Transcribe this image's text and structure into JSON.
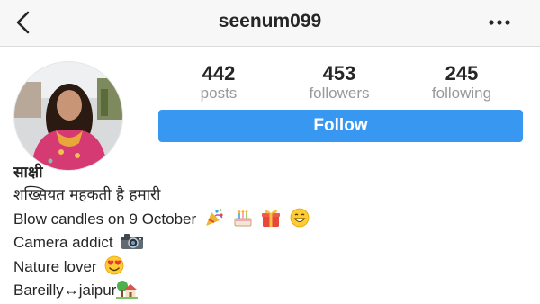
{
  "header": {
    "username": "seenum099",
    "back_icon": "chevron-left-icon",
    "more_icon": "more-horizontal-icon"
  },
  "profile": {
    "avatar_description": "profile-photo",
    "stats": [
      {
        "value": "442",
        "label": "posts"
      },
      {
        "value": "453",
        "label": "followers"
      },
      {
        "value": "245",
        "label": "following"
      }
    ],
    "follow_label": "Follow",
    "accent_color": "#3897f0"
  },
  "bio": {
    "name": "साक्षी",
    "lines": [
      {
        "text": "शख्सियत महकती है हमारी",
        "emojis": []
      },
      {
        "text": "Blow candles on 9 October",
        "emojis": [
          "party-popper-icon",
          "birthday-cake-icon",
          "gift-icon",
          "grinning-face-icon"
        ]
      },
      {
        "text": "Camera addict",
        "emojis": [
          "camera-icon"
        ]
      },
      {
        "text": "Nature lover",
        "emojis": [
          "heart-eyes-icon"
        ]
      },
      {
        "text": "Bareilly↔jaipur",
        "emojis": [
          "house-with-garden-icon"
        ]
      }
    ]
  }
}
